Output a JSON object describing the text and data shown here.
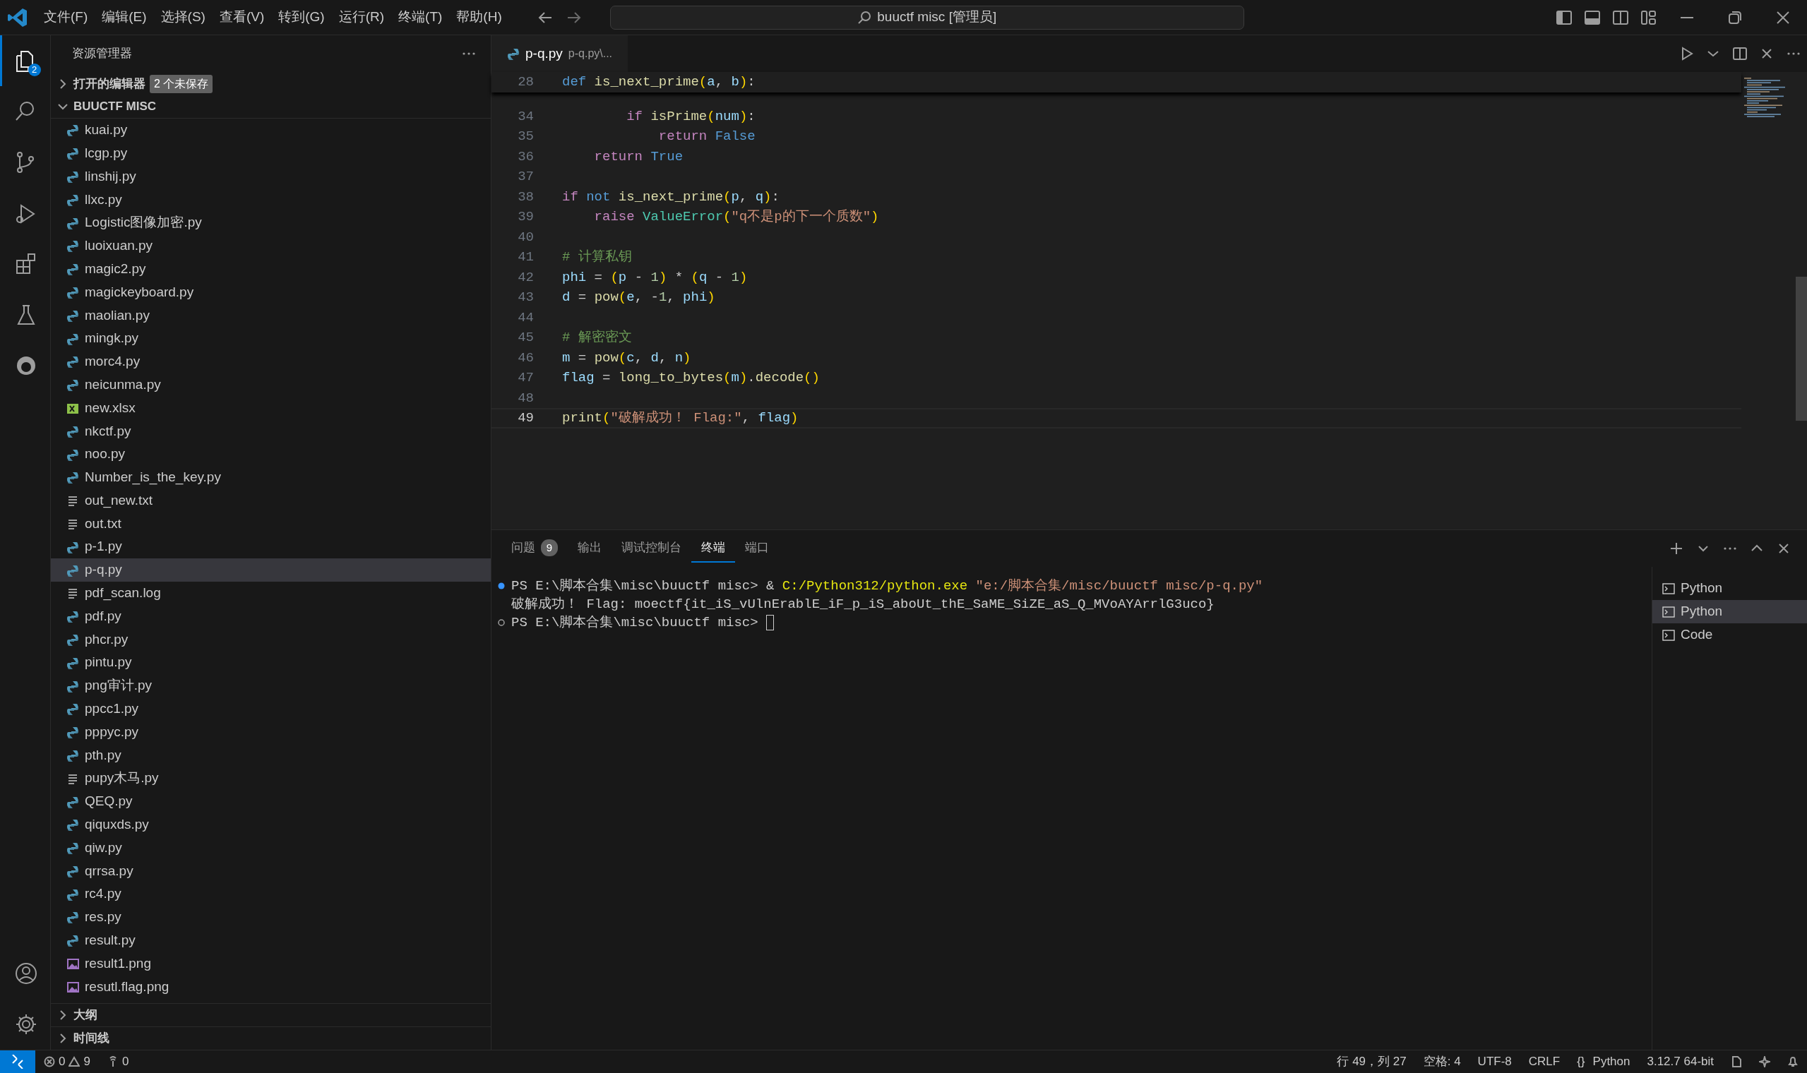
{
  "title_bar": {
    "menu": [
      "文件(F)",
      "编辑(E)",
      "选择(S)",
      "查看(V)",
      "转到(G)",
      "运行(R)",
      "终端(T)",
      "帮助(H)"
    ],
    "search": "buuctf misc [管理员]"
  },
  "activity_bar": {
    "items": [
      {
        "kind": "explorer",
        "selected": true,
        "badge": "2"
      },
      {
        "kind": "search",
        "selected": false
      },
      {
        "kind": "source-control",
        "selected": false
      },
      {
        "kind": "run",
        "selected": false
      },
      {
        "kind": "extensions",
        "selected": false
      },
      {
        "kind": "testing",
        "selected": false
      },
      {
        "kind": "remote",
        "selected": false
      }
    ],
    "bottom": [
      {
        "kind": "account"
      },
      {
        "kind": "settings"
      }
    ]
  },
  "sidebar": {
    "title": "资源管理器",
    "open_editors": {
      "label": "打开的编辑器",
      "badge": "2 个未保存",
      "expanded": false
    },
    "folder": {
      "label": "BUUCTF MISC",
      "expanded": true
    },
    "files": [
      {
        "name": "kuai.py",
        "kind": "python",
        "selected": false
      },
      {
        "name": "lcgp.py",
        "kind": "python",
        "selected": false
      },
      {
        "name": "linshij.py",
        "kind": "python",
        "selected": false
      },
      {
        "name": "llxc.py",
        "kind": "python",
        "selected": false
      },
      {
        "name": "Logistic图像加密.py",
        "kind": "python",
        "selected": false
      },
      {
        "name": "luoixuan.py",
        "kind": "python",
        "selected": false
      },
      {
        "name": "magic2.py",
        "kind": "python",
        "selected": false
      },
      {
        "name": "magickeyboard.py",
        "kind": "python",
        "selected": false
      },
      {
        "name": "maolian.py",
        "kind": "python",
        "selected": false
      },
      {
        "name": "mingk.py",
        "kind": "python",
        "selected": false
      },
      {
        "name": "morc4.py",
        "kind": "python",
        "selected": false
      },
      {
        "name": "neicunma.py",
        "kind": "python",
        "selected": false
      },
      {
        "name": "new.xlsx",
        "kind": "excel",
        "selected": false
      },
      {
        "name": "nkctf.py",
        "kind": "python",
        "selected": false
      },
      {
        "name": "noo.py",
        "kind": "python",
        "selected": false
      },
      {
        "name": "Number_is_the_key.py",
        "kind": "python",
        "selected": false
      },
      {
        "name": "out_new.txt",
        "kind": "text",
        "selected": false
      },
      {
        "name": "out.txt",
        "kind": "text",
        "selected": false
      },
      {
        "name": "p-1.py",
        "kind": "python",
        "selected": false
      },
      {
        "name": "p-q.py",
        "kind": "python",
        "selected": true
      },
      {
        "name": "pdf_scan.log",
        "kind": "text",
        "selected": false
      },
      {
        "name": "pdf.py",
        "kind": "python",
        "selected": false
      },
      {
        "name": "phcr.py",
        "kind": "python",
        "selected": false
      },
      {
        "name": "pintu.py",
        "kind": "python",
        "selected": false
      },
      {
        "name": "png审计.py",
        "kind": "python",
        "selected": false
      },
      {
        "name": "ppcc1.py",
        "kind": "python",
        "selected": false
      },
      {
        "name": "pppyc.py",
        "kind": "python",
        "selected": false
      },
      {
        "name": "pth.py",
        "kind": "python",
        "selected": false
      },
      {
        "name": "pupy木马.py",
        "kind": "text",
        "selected": false
      },
      {
        "name": "QEQ.py",
        "kind": "python",
        "selected": false
      },
      {
        "name": "qiquxds.py",
        "kind": "python",
        "selected": false
      },
      {
        "name": "qiw.py",
        "kind": "python",
        "selected": false
      },
      {
        "name": "qrrsa.py",
        "kind": "python",
        "selected": false
      },
      {
        "name": "rc4.py",
        "kind": "python",
        "selected": false
      },
      {
        "name": "res.py",
        "kind": "python",
        "selected": false
      },
      {
        "name": "result.py",
        "kind": "python",
        "selected": false
      },
      {
        "name": "result1.png",
        "kind": "image",
        "selected": false
      },
      {
        "name": "resutl.flag.png",
        "kind": "image",
        "selected": false
      }
    ],
    "sections": [
      {
        "label": "大纲",
        "expanded": false
      },
      {
        "label": "时间线",
        "expanded": false
      }
    ]
  },
  "editor": {
    "tab": {
      "name": "p-q.py",
      "description": "p-q.py\\..."
    },
    "sticky_line": {
      "number": "28",
      "tokens": [
        {
          "kind": "keyword",
          "text": "def "
        },
        {
          "kind": "function",
          "text": "is_next_prime"
        },
        {
          "kind": "bracket",
          "text": "("
        },
        {
          "kind": "variable",
          "text": "a"
        },
        {
          "kind": "plain",
          "text": ", "
        },
        {
          "kind": "variable",
          "text": "b"
        },
        {
          "kind": "bracket",
          "text": ")"
        },
        {
          "kind": "plain",
          "text": ":"
        }
      ]
    },
    "lines": [
      {
        "number": "34",
        "current": false,
        "tokens": [
          {
            "kind": "control",
            "text": "        if "
          },
          {
            "kind": "function",
            "text": "isPrime"
          },
          {
            "kind": "bracket",
            "text": "("
          },
          {
            "kind": "variable",
            "text": "num"
          },
          {
            "kind": "bracket",
            "text": ")"
          },
          {
            "kind": "plain",
            "text": ":"
          }
        ]
      },
      {
        "number": "35",
        "current": false,
        "tokens": [
          {
            "kind": "control",
            "text": "            return "
          },
          {
            "kind": "constant",
            "text": "False"
          }
        ]
      },
      {
        "number": "36",
        "current": false,
        "tokens": [
          {
            "kind": "control",
            "text": "    return "
          },
          {
            "kind": "constant",
            "text": "True"
          }
        ]
      },
      {
        "number": "37",
        "current": false
      },
      {
        "number": "38",
        "current": false,
        "tokens": [
          {
            "kind": "control",
            "text": "if "
          },
          {
            "kind": "keyword",
            "text": "not "
          },
          {
            "kind": "function",
            "text": "is_next_prime"
          },
          {
            "kind": "bracket",
            "text": "("
          },
          {
            "kind": "variable",
            "text": "p"
          },
          {
            "kind": "plain",
            "text": ", "
          },
          {
            "kind": "variable",
            "text": "q"
          },
          {
            "kind": "bracket",
            "text": ")"
          },
          {
            "kind": "plain",
            "text": ":"
          }
        ]
      },
      {
        "number": "39",
        "current": false,
        "tokens": [
          {
            "kind": "control",
            "text": "    raise "
          },
          {
            "kind": "class",
            "text": "ValueError"
          },
          {
            "kind": "bracket",
            "text": "("
          },
          {
            "kind": "string",
            "text": "\"q不是p的下一个质数\""
          },
          {
            "kind": "bracket",
            "text": ")"
          }
        ]
      },
      {
        "number": "40",
        "current": false
      },
      {
        "number": "41",
        "current": false,
        "tokens": [
          {
            "kind": "comment",
            "text": "# 计算私钥"
          }
        ]
      },
      {
        "number": "42",
        "current": false,
        "tokens": [
          {
            "kind": "variable",
            "text": "phi"
          },
          {
            "kind": "plain",
            "text": " = "
          },
          {
            "kind": "bracket",
            "text": "("
          },
          {
            "kind": "variable",
            "text": "p"
          },
          {
            "kind": "plain",
            "text": " - "
          },
          {
            "kind": "number",
            "text": "1"
          },
          {
            "kind": "bracket",
            "text": ")"
          },
          {
            "kind": "plain",
            "text": " * "
          },
          {
            "kind": "bracket",
            "text": "("
          },
          {
            "kind": "variable",
            "text": "q"
          },
          {
            "kind": "plain",
            "text": " - "
          },
          {
            "kind": "number",
            "text": "1"
          },
          {
            "kind": "bracket",
            "text": ")"
          }
        ]
      },
      {
        "number": "43",
        "current": false,
        "tokens": [
          {
            "kind": "variable",
            "text": "d"
          },
          {
            "kind": "plain",
            "text": " = "
          },
          {
            "kind": "function",
            "text": "pow"
          },
          {
            "kind": "bracket",
            "text": "("
          },
          {
            "kind": "variable",
            "text": "e"
          },
          {
            "kind": "plain",
            "text": ", -"
          },
          {
            "kind": "number",
            "text": "1"
          },
          {
            "kind": "plain",
            "text": ", "
          },
          {
            "kind": "variable",
            "text": "phi"
          },
          {
            "kind": "bracket",
            "text": ")"
          }
        ]
      },
      {
        "number": "44",
        "current": false
      },
      {
        "number": "45",
        "current": false,
        "tokens": [
          {
            "kind": "comment",
            "text": "# 解密密文"
          }
        ]
      },
      {
        "number": "46",
        "current": false,
        "tokens": [
          {
            "kind": "variable",
            "text": "m"
          },
          {
            "kind": "plain",
            "text": " = "
          },
          {
            "kind": "function",
            "text": "pow"
          },
          {
            "kind": "bracket",
            "text": "("
          },
          {
            "kind": "variable",
            "text": "c"
          },
          {
            "kind": "plain",
            "text": ", "
          },
          {
            "kind": "variable",
            "text": "d"
          },
          {
            "kind": "plain",
            "text": ", "
          },
          {
            "kind": "variable",
            "text": "n"
          },
          {
            "kind": "bracket",
            "text": ")"
          }
        ]
      },
      {
        "number": "47",
        "current": false,
        "tokens": [
          {
            "kind": "variable",
            "text": "flag"
          },
          {
            "kind": "plain",
            "text": " = "
          },
          {
            "kind": "function",
            "text": "long_to_bytes"
          },
          {
            "kind": "bracket",
            "text": "("
          },
          {
            "kind": "variable",
            "text": "m"
          },
          {
            "kind": "bracket",
            "text": ")"
          },
          {
            "kind": "plain",
            "text": "."
          },
          {
            "kind": "function",
            "text": "decode"
          },
          {
            "kind": "bracket",
            "text": "()"
          }
        ]
      },
      {
        "number": "48",
        "current": false
      },
      {
        "number": "49",
        "current": true,
        "tokens": [
          {
            "kind": "function",
            "text": "print"
          },
          {
            "kind": "bracket",
            "text": "("
          },
          {
            "kind": "string",
            "text": "\"破解成功！ Flag:\""
          },
          {
            "kind": "plain",
            "text": ", "
          },
          {
            "kind": "variable",
            "text": "flag"
          },
          {
            "kind": "bracket",
            "text": ")"
          }
        ]
      }
    ]
  },
  "panel": {
    "tabs": [
      {
        "label": "问题",
        "selected": false,
        "badge": "9"
      },
      {
        "label": "输出",
        "selected": false
      },
      {
        "label": "调试控制台",
        "selected": false
      },
      {
        "label": "终端",
        "selected": true
      },
      {
        "label": "端口",
        "selected": false
      }
    ],
    "terminal_lines": [
      {
        "kind": "succeeded",
        "segments": [
          {
            "kind": "plain",
            "text": "PS E:\\脚本合集\\misc\\buuctf misc> & "
          },
          {
            "kind": "command",
            "text": "C:/Python312/python.exe "
          },
          {
            "kind": "string",
            "text": "\"e:/脚本合集/misc/buuctf misc/p-q.py\""
          }
        ]
      },
      {
        "kind": "output",
        "segments": [
          {
            "kind": "plain",
            "text": "破解成功！ Flag: moectf{it_iS_vUlnErablE_iF_p_iS_aboUt_thE_SaME_SiZE_aS_Q_MVoAYArrlG3uco}"
          }
        ]
      },
      {
        "kind": "prompt",
        "cursor": true,
        "segments": [
          {
            "kind": "plain",
            "text": "PS E:\\脚本合集\\misc\\buuctf misc> "
          }
        ]
      }
    ],
    "terminals": [
      {
        "label": "Python",
        "selected": false
      },
      {
        "label": "Python",
        "selected": true
      },
      {
        "label": "Code",
        "selected": false
      }
    ]
  },
  "status_bar": {
    "errors": "0",
    "warnings": "9",
    "ports": "0",
    "items": [
      {
        "kind": "text",
        "text": "行 49，列 27"
      },
      {
        "kind": "text",
        "text": "空格: 4"
      },
      {
        "kind": "text",
        "text": "UTF-8"
      },
      {
        "kind": "text",
        "text": "CRLF"
      },
      {
        "kind": "language",
        "icon": "{}",
        "text": "Python"
      },
      {
        "kind": "text",
        "text": "3.12.7 64-bit"
      }
    ]
  }
}
